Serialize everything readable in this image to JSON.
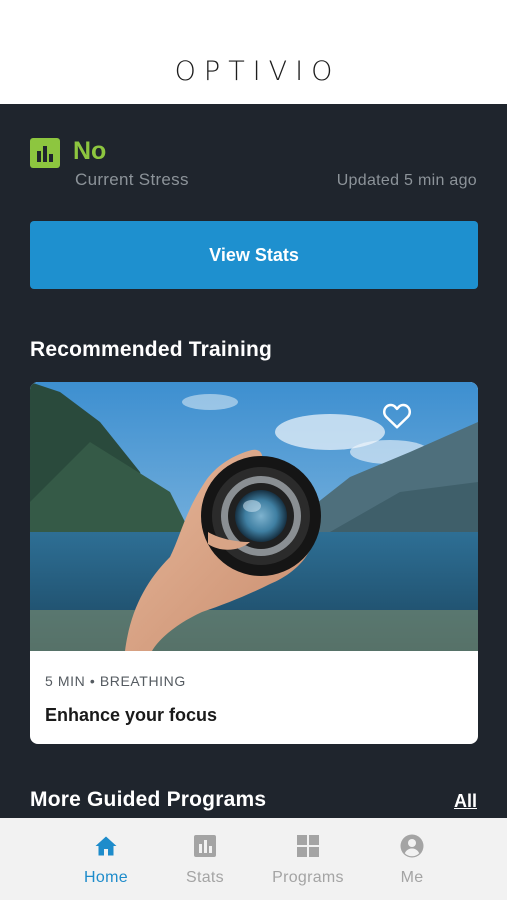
{
  "header": {
    "logo": "OPTIVIO"
  },
  "stress": {
    "value": "No",
    "label": "Current Stress",
    "updated": "Updated 5 min ago",
    "color": "#8dc63f"
  },
  "actions": {
    "view_stats": "View Stats"
  },
  "recommended": {
    "title": "Recommended Training",
    "card": {
      "meta": "5 MIN • BREATHING",
      "title": "Enhance your focus",
      "favorite_icon": "heart-outline-icon"
    }
  },
  "more": {
    "title": "More Guided Programs",
    "all_link": "All"
  },
  "tabbar": {
    "tabs": [
      {
        "label": "Home",
        "icon": "home-icon",
        "active": true
      },
      {
        "label": "Stats",
        "icon": "bar-chart-icon",
        "active": false
      },
      {
        "label": "Programs",
        "icon": "grid-icon",
        "active": false
      },
      {
        "label": "Me",
        "icon": "user-circle-icon",
        "active": false
      }
    ]
  },
  "colors": {
    "accent": "#1e90cf",
    "background": "#1f252d",
    "stress_green": "#8dc63f"
  }
}
